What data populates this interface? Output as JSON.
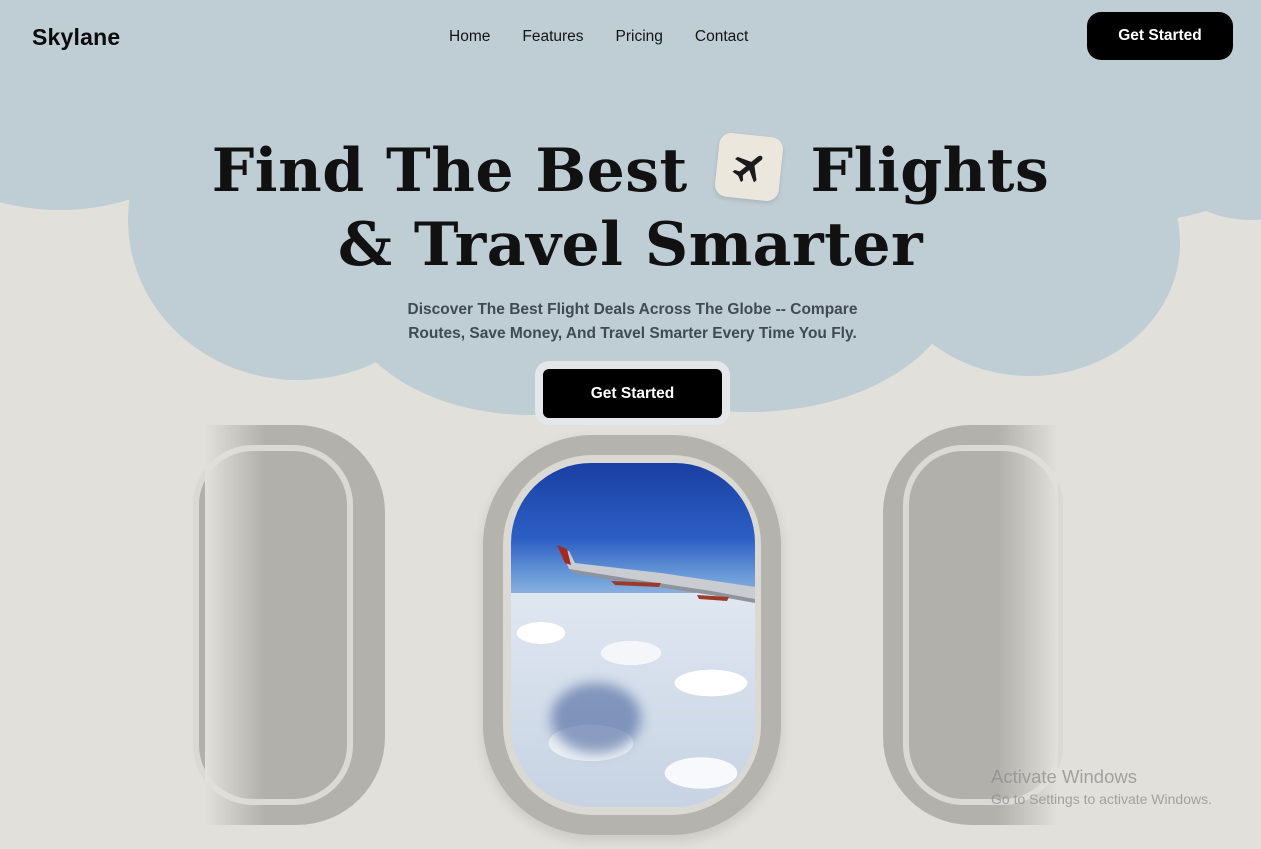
{
  "brand": {
    "name": "Skylane"
  },
  "nav": {
    "items": [
      {
        "label": "Home"
      },
      {
        "label": "Features"
      },
      {
        "label": "Pricing"
      },
      {
        "label": "Contact"
      }
    ],
    "cta_label": "Get Started"
  },
  "hero": {
    "title_line1_part1": "Find The Best",
    "title_icon": "airplane-icon",
    "title_line1_part2": "Flights",
    "title_line2": "& Travel Smarter",
    "subtitle": "Discover The Best Flight Deals Across The Globe -- Compare Routes, Save Money, And Travel Smarter Every Time You Fly.",
    "cta_label": "Get Started"
  },
  "watermark": {
    "line1": "Activate Windows",
    "line2": "Go to Settings to activate Windows."
  },
  "colors": {
    "sky": "#bfcdd5",
    "background": "#e1e0da",
    "button": "#000000"
  }
}
